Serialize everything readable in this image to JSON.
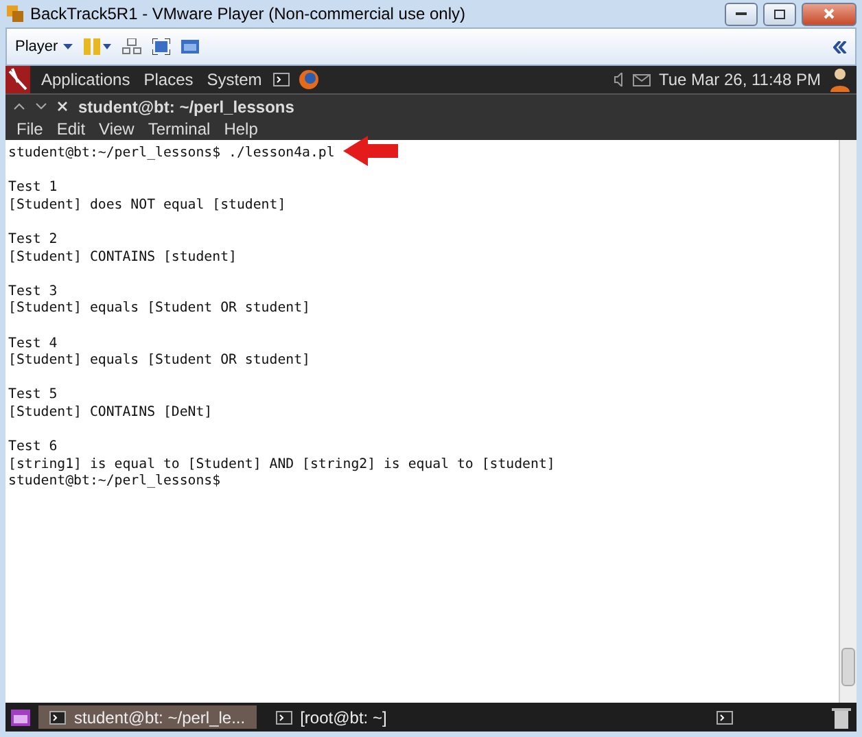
{
  "window": {
    "title": "BackTrack5R1 - VMware Player (Non-commercial use only)"
  },
  "toolbar": {
    "player_menu": "Player"
  },
  "panel": {
    "menus": [
      "Applications",
      "Places",
      "System"
    ],
    "clock": "Tue Mar 26, 11:48 PM"
  },
  "terminal": {
    "title": "student@bt: ~/perl_lessons",
    "menu": [
      "File",
      "Edit",
      "View",
      "Terminal",
      "Help"
    ],
    "command": "student@bt:~/perl_lessons$ ./lesson4a.pl",
    "tests": [
      {
        "title": "Test 1",
        "result": "[Student] does NOT equal [student]"
      },
      {
        "title": "Test 2",
        "result": "[Student] CONTAINS [student]"
      },
      {
        "title": "Test 3",
        "result": "[Student] equals [Student OR student]"
      },
      {
        "title": "Test 4",
        "result": "[Student] equals [Student OR student]"
      },
      {
        "title": "Test 5",
        "result": "[Student] CONTAINS [DeNt]"
      },
      {
        "title": "Test 6",
        "result": "[string1] is equal to [Student] AND [string2] is equal to [student]"
      }
    ],
    "final_prompt": "student@bt:~/perl_lessons$"
  },
  "taskbar": {
    "tasks": [
      {
        "label": "student@bt: ~/perl_le...",
        "selected": true
      },
      {
        "label": "[root@bt: ~]",
        "selected": false
      }
    ]
  }
}
